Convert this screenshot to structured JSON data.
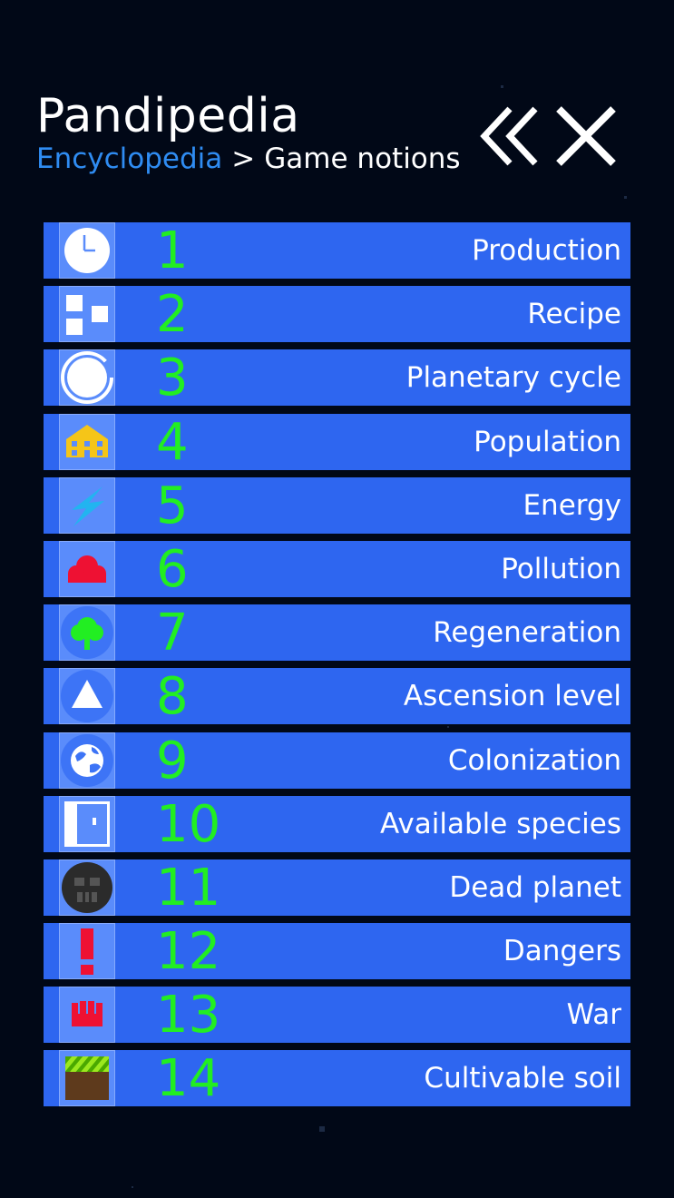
{
  "header": {
    "title": "Pandipedia",
    "breadcrumb_root": "Encyclopedia",
    "breadcrumb_separator": ">",
    "breadcrumb_current": "Game notions"
  },
  "colors": {
    "background": "#010817",
    "row": "#2e66f0",
    "number": "#22ee22",
    "link": "#2f8cf2"
  },
  "items": [
    {
      "number": "1",
      "label": "Production",
      "icon": "clock-icon"
    },
    {
      "number": "2",
      "label": "Recipe",
      "icon": "blocks-icon"
    },
    {
      "number": "3",
      "label": "Planetary cycle",
      "icon": "cycle-icon"
    },
    {
      "number": "4",
      "label": "Population",
      "icon": "building-icon"
    },
    {
      "number": "5",
      "label": "Energy",
      "icon": "lightning-icon"
    },
    {
      "number": "6",
      "label": "Pollution",
      "icon": "cloud-icon"
    },
    {
      "number": "7",
      "label": "Regeneration",
      "icon": "tree-icon"
    },
    {
      "number": "8",
      "label": "Ascension level",
      "icon": "triangle-icon"
    },
    {
      "number": "9",
      "label": "Colonization",
      "icon": "globe-icon"
    },
    {
      "number": "10",
      "label": "Available species",
      "icon": "door-icon"
    },
    {
      "number": "11",
      "label": "Dead planet",
      "icon": "skull-planet-icon"
    },
    {
      "number": "12",
      "label": "Dangers",
      "icon": "exclamation-icon"
    },
    {
      "number": "13",
      "label": "War",
      "icon": "fist-icon"
    },
    {
      "number": "14",
      "label": "Cultivable soil",
      "icon": "soil-icon"
    }
  ]
}
